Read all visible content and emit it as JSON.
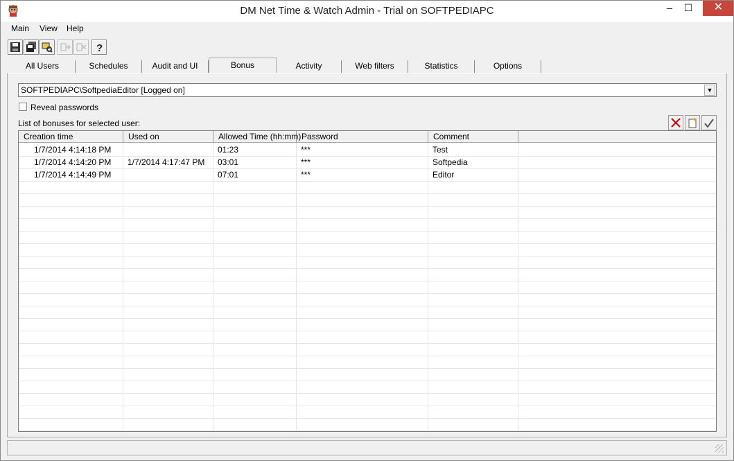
{
  "window": {
    "title": "DM Net Time & Watch Admin - Trial on SOFTPEDIAPC",
    "controls": {
      "minimize": "–",
      "maximize": "☐",
      "close": "✕"
    }
  },
  "menu": [
    "Main",
    "View",
    "Help"
  ],
  "toolbar": {
    "icons": [
      "save-icon",
      "save-all-icon",
      "find-icon",
      "forward-disabled-icon",
      "forward-all-disabled-icon",
      "help-icon"
    ],
    "help_glyph": "?"
  },
  "tabs": [
    {
      "label": "All Users"
    },
    {
      "label": "Schedules"
    },
    {
      "label": "Audit and UI"
    },
    {
      "label": "Bonus",
      "active": true
    },
    {
      "label": "Activity"
    },
    {
      "label": "Web filters"
    },
    {
      "label": "Statistics"
    },
    {
      "label": "Options"
    }
  ],
  "bonus": {
    "user_select": "SOFTPEDIAPC\\SoftpediaEditor  [Logged on]",
    "dropdown_glyph": "▼",
    "reveal_label": "Reveal passwords",
    "reveal_checked": false,
    "list_caption": "List of bonuses for selected user:",
    "columns": [
      "Creation time",
      "Used on",
      "Allowed Time (hh:mm)",
      "Password",
      "Comment"
    ],
    "rows": [
      {
        "creation": "1/7/2014 4:14:18 PM",
        "used": "",
        "allowed": "01:23",
        "password": "***",
        "comment": "Test"
      },
      {
        "creation": "1/7/2014 4:14:20 PM",
        "used": "1/7/2014 4:17:47 PM",
        "allowed": "03:01",
        "password": "***",
        "comment": "Softpedia"
      },
      {
        "creation": "1/7/2014 4:14:49 PM",
        "used": "",
        "allowed": "07:01",
        "password": "***",
        "comment": "Editor"
      }
    ],
    "action_icons": [
      "delete-icon",
      "new-bonus-icon",
      "clear-icon"
    ]
  },
  "colors": {
    "accent_close": "#c7463b",
    "delete_red": "#cc0000"
  }
}
